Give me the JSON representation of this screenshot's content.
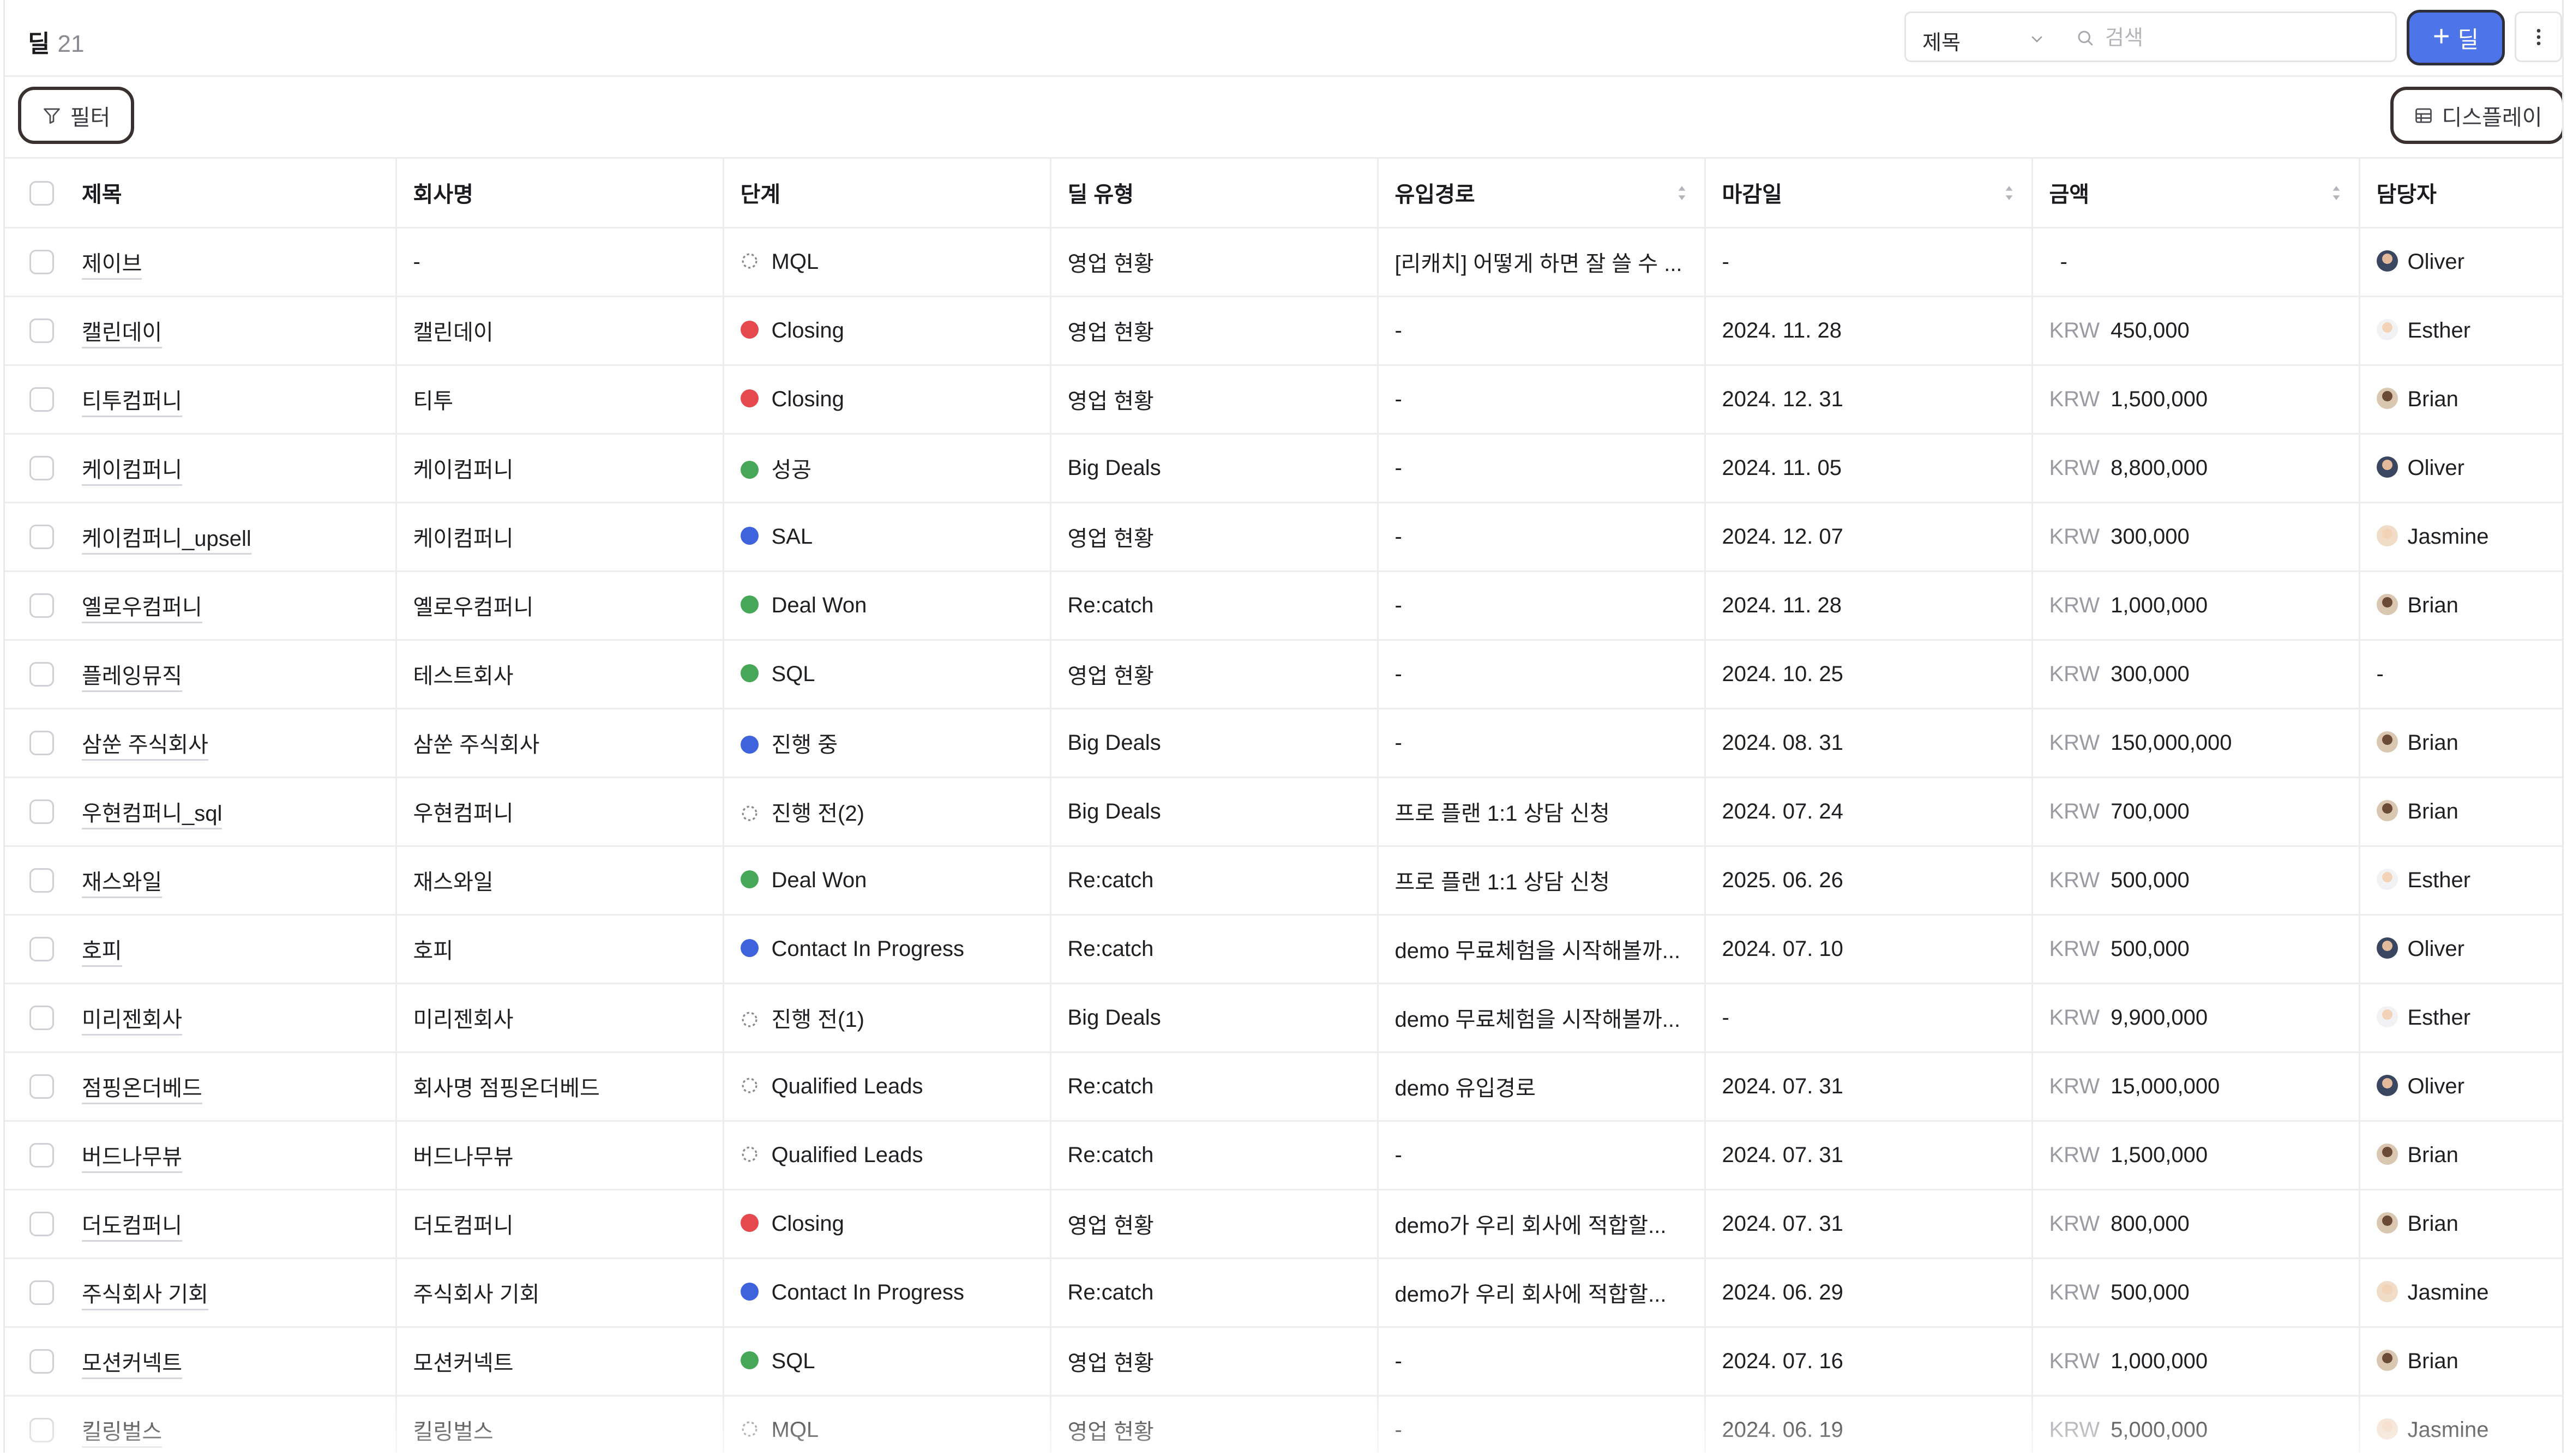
{
  "header": {
    "title": "딜",
    "count": "21",
    "field_select": "제목",
    "search_placeholder": "검색",
    "add_button": "딜"
  },
  "toolbar": {
    "filter": "필터",
    "display": "디스플레이"
  },
  "columns": {
    "title": "제목",
    "company": "회사명",
    "stage": "단계",
    "deal_type": "딜 유형",
    "source": "유입경로",
    "due": "마감일",
    "amount": "금액",
    "owner": "담당자"
  },
  "colors": {
    "accent": "#4d74e8",
    "red": "#e5484d",
    "green": "#46a758",
    "blue": "#3e63dd"
  },
  "rows": [
    {
      "title": "제이브",
      "company": "-",
      "stage": "MQL",
      "stage_icon": "dashed",
      "deal_type": "영업 현황",
      "source": "[리캐치] 어떻게 하면 잘 쓸 수 ...",
      "due": "-",
      "currency": "",
      "amount": "-",
      "owner": "Oliver",
      "avatar": "o"
    },
    {
      "title": "캘린데이",
      "company": "캘린데이",
      "stage": "Closing",
      "stage_icon": "red",
      "deal_type": "영업 현황",
      "source": "-",
      "due": "2024. 11. 28",
      "currency": "KRW",
      "amount": "450,000",
      "owner": "Esther",
      "avatar": "e"
    },
    {
      "title": "티투컴퍼니",
      "company": "티투",
      "stage": "Closing",
      "stage_icon": "red",
      "deal_type": "영업 현황",
      "source": "-",
      "due": "2024. 12. 31",
      "currency": "KRW",
      "amount": "1,500,000",
      "owner": "Brian",
      "avatar": "b"
    },
    {
      "title": "케이컴퍼니",
      "company": "케이컴퍼니",
      "stage": "성공",
      "stage_icon": "green",
      "deal_type": "Big Deals",
      "source": "-",
      "due": "2024. 11. 05",
      "currency": "KRW",
      "amount": "8,800,000",
      "owner": "Oliver",
      "avatar": "o"
    },
    {
      "title": "케이컴퍼니_upsell",
      "company": "케이컴퍼니",
      "stage": "SAL",
      "stage_icon": "blue",
      "deal_type": "영업 현황",
      "source": "-",
      "due": "2024. 12. 07",
      "currency": "KRW",
      "amount": "300,000",
      "owner": "Jasmine",
      "avatar": "j"
    },
    {
      "title": "옐로우컴퍼니",
      "company": "옐로우컴퍼니",
      "stage": "Deal Won",
      "stage_icon": "green",
      "deal_type": "Re:catch",
      "source": "-",
      "due": "2024. 11. 28",
      "currency": "KRW",
      "amount": "1,000,000",
      "owner": "Brian",
      "avatar": "b"
    },
    {
      "title": "플레잉뮤직",
      "company": "테스트회사",
      "stage": "SQL",
      "stage_icon": "green",
      "deal_type": "영업 현황",
      "source": "-",
      "due": "2024. 10. 25",
      "currency": "KRW",
      "amount": "300,000",
      "owner": "-",
      "avatar": ""
    },
    {
      "title": "삼쑨 주식회사",
      "company": "삼쑨 주식회사",
      "stage": "진행 중",
      "stage_icon": "blue",
      "deal_type": "Big Deals",
      "source": "-",
      "due": "2024. 08. 31",
      "currency": "KRW",
      "amount": "150,000,000",
      "owner": "Brian",
      "avatar": "b"
    },
    {
      "title": "우현컴퍼니_sql",
      "company": "우현컴퍼니",
      "stage": "진행 전(2)",
      "stage_icon": "dashed",
      "deal_type": "Big Deals",
      "source": "프로 플랜 1:1 상담 신청",
      "due": "2024. 07. 24",
      "currency": "KRW",
      "amount": "700,000",
      "owner": "Brian",
      "avatar": "b"
    },
    {
      "title": "재스와일",
      "company": "재스와일",
      "stage": "Deal Won",
      "stage_icon": "green",
      "deal_type": "Re:catch",
      "source": "프로 플랜 1:1 상담 신청",
      "due": "2025. 06. 26",
      "currency": "KRW",
      "amount": "500,000",
      "owner": "Esther",
      "avatar": "e"
    },
    {
      "title": "호피",
      "company": "호피",
      "stage": "Contact In Progress",
      "stage_icon": "blue",
      "deal_type": "Re:catch",
      "source": "demo 무료체험을 시작해볼까...",
      "due": "2024. 07. 10",
      "currency": "KRW",
      "amount": "500,000",
      "owner": "Oliver",
      "avatar": "o"
    },
    {
      "title": "미리젠회사",
      "company": "미리젠회사",
      "stage": "진행 전(1)",
      "stage_icon": "dashed",
      "deal_type": "Big Deals",
      "source": "demo 무료체험을 시작해볼까...",
      "due": "-",
      "currency": "KRW",
      "amount": "9,900,000",
      "owner": "Esther",
      "avatar": "e"
    },
    {
      "title": "점핑온더베드",
      "company": "회사명 점핑온더베드",
      "stage": "Qualified Leads",
      "stage_icon": "dashed",
      "deal_type": "Re:catch",
      "source": "demo 유입경로",
      "due": "2024. 07. 31",
      "currency": "KRW",
      "amount": "15,000,000",
      "owner": "Oliver",
      "avatar": "o"
    },
    {
      "title": "버드나무뷰",
      "company": "버드나무뷰",
      "stage": "Qualified Leads",
      "stage_icon": "dashed",
      "deal_type": "Re:catch",
      "source": "-",
      "due": "2024. 07. 31",
      "currency": "KRW",
      "amount": "1,500,000",
      "owner": "Brian",
      "avatar": "b"
    },
    {
      "title": "더도컴퍼니",
      "company": "더도컴퍼니",
      "stage": "Closing",
      "stage_icon": "red",
      "deal_type": "영업 현황",
      "source": "demo가 우리 회사에 적합할...",
      "due": "2024. 07. 31",
      "currency": "KRW",
      "amount": "800,000",
      "owner": "Brian",
      "avatar": "b"
    },
    {
      "title": "주식회사 기회",
      "company": "주식회사 기회",
      "stage": "Contact In Progress",
      "stage_icon": "blue",
      "deal_type": "Re:catch",
      "source": "demo가 우리 회사에 적합할...",
      "due": "2024. 06. 29",
      "currency": "KRW",
      "amount": "500,000",
      "owner": "Jasmine",
      "avatar": "j"
    },
    {
      "title": "모션커넥트",
      "company": "모션커넥트",
      "stage": "SQL",
      "stage_icon": "green",
      "deal_type": "영업 현황",
      "source": "-",
      "due": "2024. 07. 16",
      "currency": "KRW",
      "amount": "1,000,000",
      "owner": "Brian",
      "avatar": "b"
    },
    {
      "title": "킬링벌스",
      "company": "킬링벌스",
      "stage": "MQL",
      "stage_icon": "dashed",
      "deal_type": "영업 현황",
      "source": "-",
      "due": "2024. 06. 19",
      "currency": "KRW",
      "amount": "5,000,000",
      "owner": "Jasmine",
      "avatar": "j"
    }
  ]
}
